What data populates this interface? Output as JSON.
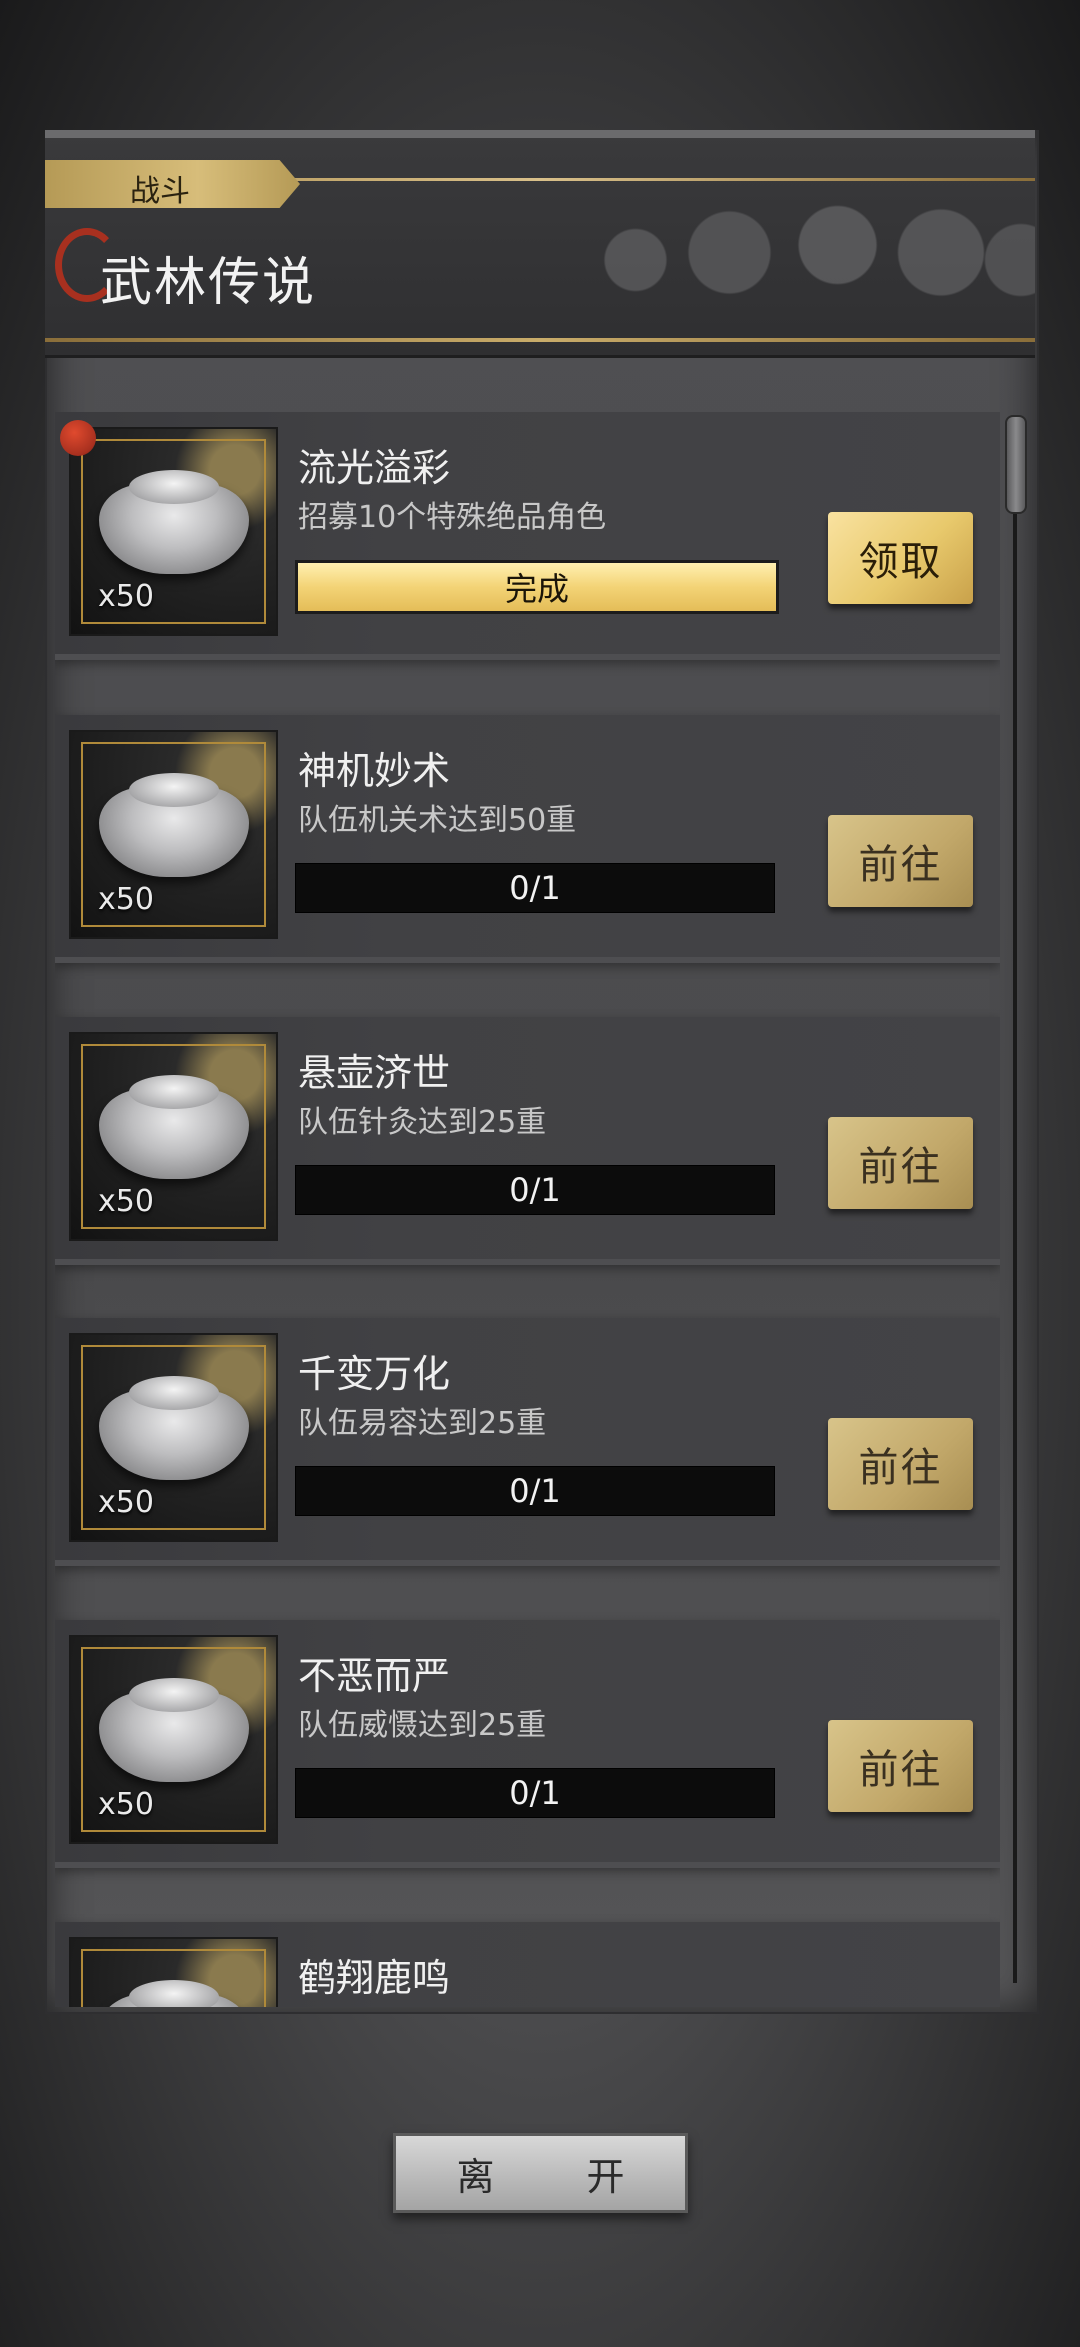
{
  "header": {
    "tab_label": "战斗",
    "title": "武林传说"
  },
  "tasks": [
    {
      "name": "流光溢彩",
      "desc": "招募10个特殊绝品角色",
      "reward_qty": "x50",
      "progress": "完成",
      "button": "领取",
      "status": "complete",
      "notify": true
    },
    {
      "name": "神机妙术",
      "desc": "队伍机关术达到50重",
      "reward_qty": "x50",
      "progress": "0/1",
      "button": "前往",
      "status": "incomplete",
      "notify": false
    },
    {
      "name": "悬壶济世",
      "desc": "队伍针灸达到25重",
      "reward_qty": "x50",
      "progress": "0/1",
      "button": "前往",
      "status": "incomplete",
      "notify": false
    },
    {
      "name": "千变万化",
      "desc": "队伍易容达到25重",
      "reward_qty": "x50",
      "progress": "0/1",
      "button": "前往",
      "status": "incomplete",
      "notify": false
    },
    {
      "name": "不恶而严",
      "desc": "队伍威慑达到25重",
      "reward_qty": "x50",
      "progress": "0/1",
      "button": "前往",
      "status": "incomplete",
      "notify": false
    },
    {
      "name": "鹤翔鹿鸣",
      "desc": "",
      "reward_qty": "",
      "progress": "",
      "button": "",
      "status": "partial",
      "notify": false
    }
  ],
  "footer": {
    "leave_label": "离 开"
  },
  "colors": {
    "gold_accent": "#d7bd7a",
    "notify_red": "#a8301f",
    "complete_bar": "#f3d376"
  }
}
